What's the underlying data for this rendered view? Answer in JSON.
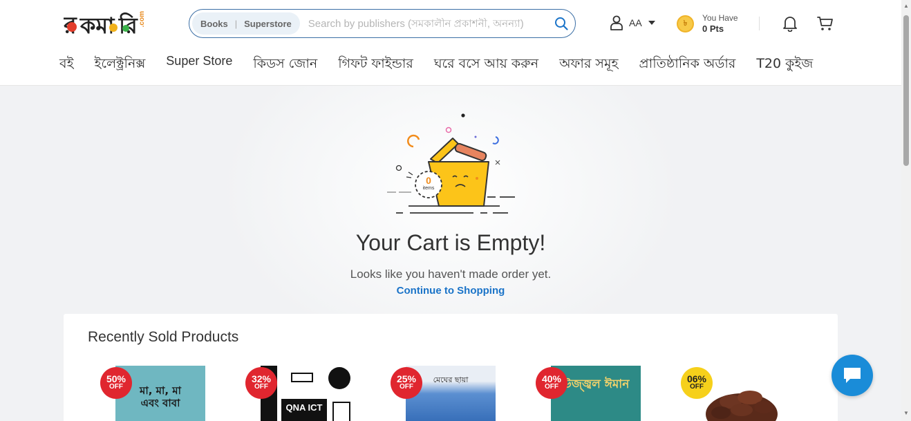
{
  "header": {
    "logo_text_main": "রকমারি",
    "logo_text_suffix": ".com",
    "search": {
      "tab_books": "Books",
      "tab_separator": "|",
      "tab_superstore": "Superstore",
      "placeholder": "Search by publishers (সমকালীন প্রকাশনী, অনন্যা)"
    },
    "account": {
      "name": "AA"
    },
    "points": {
      "label": "You Have",
      "value": "0 Pts"
    }
  },
  "nav": {
    "items": [
      {
        "label": "বই"
      },
      {
        "label": "ইলেক্ট্রনিক্স"
      },
      {
        "label": "Super Store"
      },
      {
        "label": "কিডস জোন"
      },
      {
        "label": "গিফট ফাইন্ডার"
      },
      {
        "label": "ঘরে বসে আয় করুন"
      },
      {
        "label": "অফার সমূহ"
      },
      {
        "label": "প্রাতিষ্ঠানিক অর্ডার"
      },
      {
        "label": "T20 কুইজ"
      }
    ]
  },
  "empty_cart": {
    "count": "0",
    "count_unit": "items",
    "title": "Your Cart is Empty!",
    "subtitle": "Looks like you haven't made order yet.",
    "continue_label": "Continue to Shopping"
  },
  "recent": {
    "title": "Recently Sold Products",
    "products": [
      {
        "discount": "50%",
        "off": "OFF",
        "badge_color": "#e0262f",
        "cover_text": "মা, মা, মা এবং বাবা",
        "cover_color": "#6fb7c1"
      },
      {
        "discount": "32%",
        "off": "OFF",
        "badge_color": "#e0262f",
        "cover_text": "QNA ICT",
        "cover_color": "#ffffff"
      },
      {
        "discount": "25%",
        "off": "OFF",
        "badge_color": "#e0262f",
        "cover_text": "মেঘের ছায়া",
        "cover_color": "#3d78c0"
      },
      {
        "discount": "40%",
        "off": "OFF",
        "badge_color": "#e0262f",
        "cover_text": "উজ্জ্বল ঈমান",
        "cover_color": "#2d8a86"
      },
      {
        "discount": "06%",
        "off": "OFF",
        "badge_color": "#f6d01b",
        "cover_text": "",
        "cover_color": "#ffffff"
      }
    ]
  }
}
